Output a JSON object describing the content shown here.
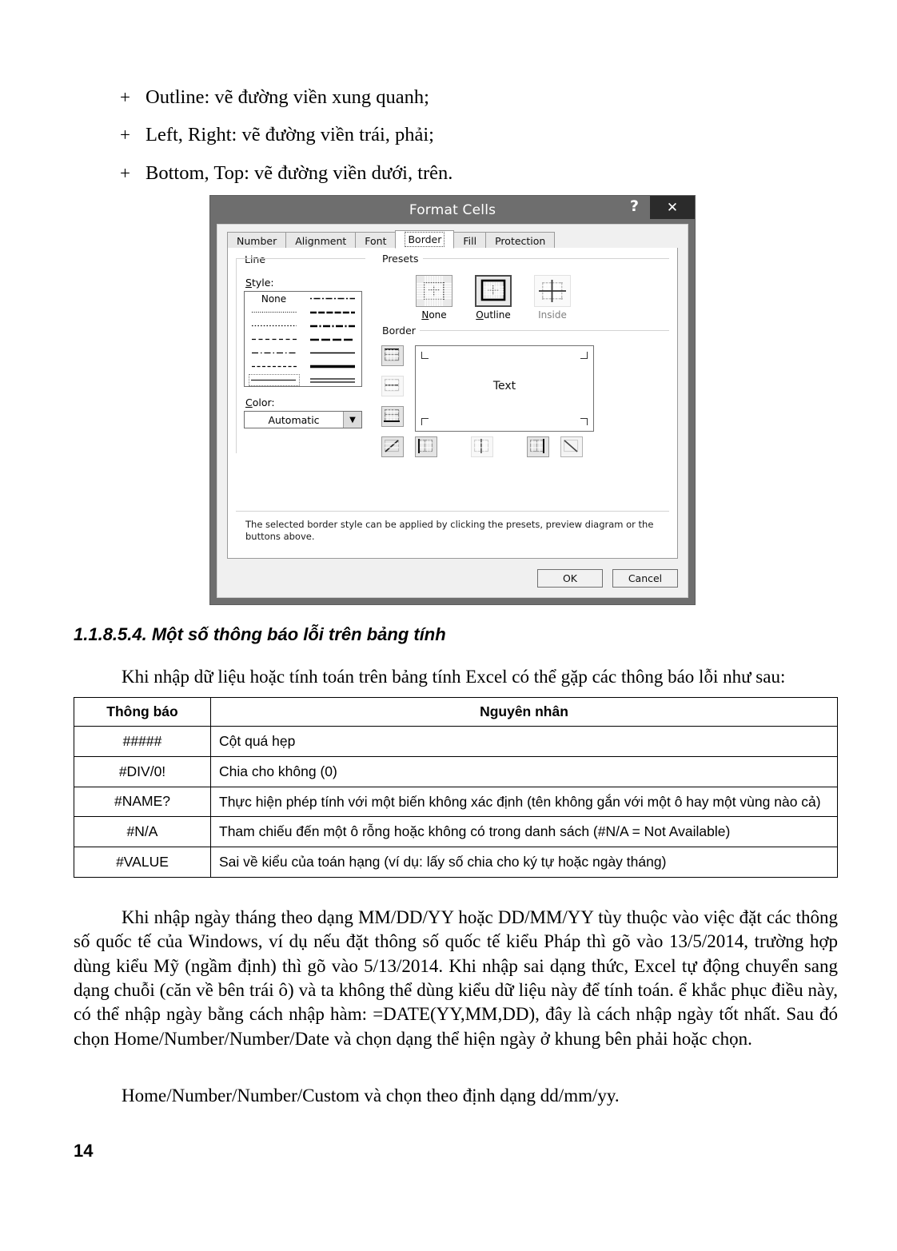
{
  "bullets": [
    {
      "marker": "+",
      "text": "Outline: vẽ đường viền xung quanh;"
    },
    {
      "marker": "+",
      "text": "Left, Right: vẽ đường viền trái, phải;"
    },
    {
      "marker": "+",
      "text": "Bottom, Top: vẽ đường viền dưới, trên."
    }
  ],
  "dialog": {
    "title": "Format Cells",
    "help_glyph": "?",
    "close_glyph": "✕",
    "tabs": [
      {
        "label": "Number",
        "active": false
      },
      {
        "label": "Alignment",
        "active": false
      },
      {
        "label": "Font",
        "active": false
      },
      {
        "label": "Border",
        "active": true
      },
      {
        "label": "Fill",
        "active": false
      },
      {
        "label": "Protection",
        "active": false
      }
    ],
    "line_group": {
      "legend": "Line",
      "style_label": "Style:",
      "none_label": "None",
      "color_label": "Color:",
      "color_value": "Automatic",
      "dropdown_glyph": "▼"
    },
    "presets_group": {
      "legend": "Presets",
      "items": [
        {
          "label": "None",
          "selected": false,
          "disabled": false
        },
        {
          "label": "Outline",
          "selected": true,
          "disabled": false
        },
        {
          "label": "Inside",
          "selected": false,
          "disabled": true
        }
      ]
    },
    "border_group": {
      "legend": "Border",
      "preview_text": "Text"
    },
    "hint": "The selected border style can be applied by clicking the presets, preview diagram or the buttons above.",
    "buttons": [
      {
        "label": "OK"
      },
      {
        "label": "Cancel"
      }
    ],
    "colors": {
      "titlebar": "#6e6e6e",
      "close_button": "#2b2b2b",
      "body": "#f0f0f0",
      "panel": "#ffffff"
    }
  },
  "section": {
    "heading": "1.1.8.5.4. Một số thông báo lỗi trên bảng tính",
    "intro": "Khi nhập dữ liệu hoặc tính toán trên bảng tính Excel có thể gặp các thông báo lỗi như sau:"
  },
  "error_table": {
    "headers": [
      "Thông báo",
      "Nguyên nhân"
    ],
    "rows": [
      {
        "code": "#####",
        "cause": "Cột quá hẹp"
      },
      {
        "code": "#DIV/0!",
        "cause": "Chia cho không (0)"
      },
      {
        "code": "#NAME?",
        "cause": "Thực hiện phép tính với một biến không xác định (tên không gắn với một ô hay một vùng nào cả)"
      },
      {
        "code": "#N/A",
        "cause": "Tham chiếu đến một ô rỗng hoặc không có trong danh sách (#N/A = Not Available)"
      },
      {
        "code": "#VALUE",
        "cause": "Sai về kiểu của toán hạng (ví dụ: lấy số chia cho ký tự hoặc ngày tháng)"
      }
    ]
  },
  "paragraphs": {
    "p1": "Khi nhập ngày tháng theo dạng MM/DD/YY hoặc DD/MM/YY tùy thuộc vào việc đặt các thông số quốc tế của Windows, ví dụ nếu đặt thông số quốc tế kiểu Pháp thì gõ vào 13/5/2014, trường hợp dùng kiểu Mỹ (ngầm định) thì gõ vào 5/13/2014. Khi nhập sai dạng thức, Excel tự động chuyển sang dạng chuỗi (căn về bên trái ô) và ta không thể dùng kiểu dữ liệu này để tính toán. ể  khắc phục điều này, có thể nhập ngày bằng cách nhập hàm: =DATE(YY,MM,DD), đây là cách nhập ngày tốt nhất. Sau đó chọn Home/Number/Number/Date và chọn dạng thể hiện ngày ở khung bên phải hoặc chọn.",
    "p2": "Home/Number/Number/Custom và chọn theo định dạng dd/mm/yy."
  },
  "page_number": "14"
}
